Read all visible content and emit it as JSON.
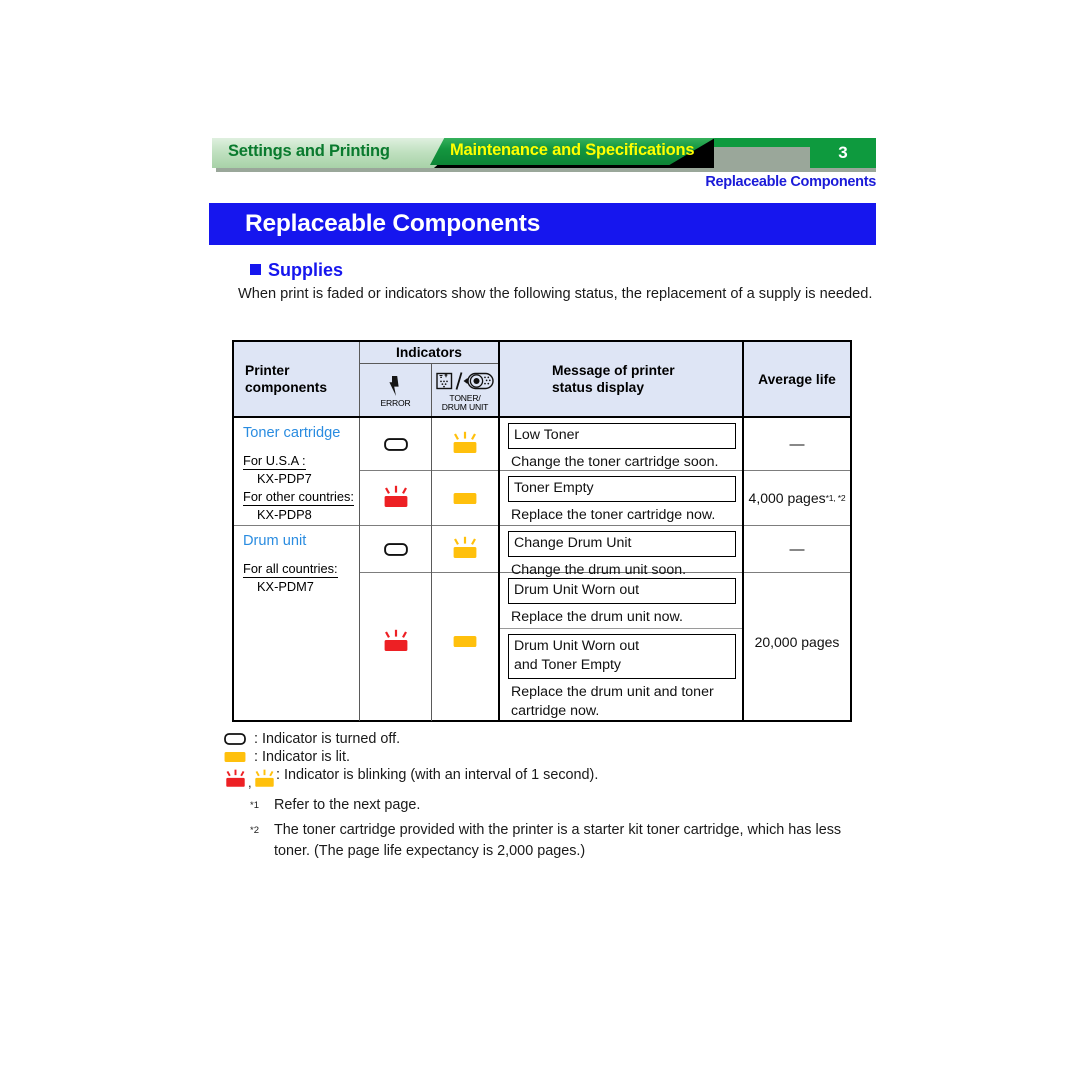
{
  "header": {
    "tab_inactive": "Settings and Printing",
    "tab_active": "Maintenance and Specifications",
    "page_number": "3",
    "running_head": "Replaceable Components",
    "colors": {
      "tab_inactive_text": "#0a7a2e",
      "tab_active_bg": "#0e9a3e",
      "tab_active_text": "#ffff00",
      "running_head_text": "#1b1bd8"
    }
  },
  "page_title": "Replaceable Components",
  "title_bg": "#1616ee",
  "section": {
    "heading": "Supplies",
    "intro": "When print is faded or indicators show the following status, the replacement of a supply is needed."
  },
  "table": {
    "headers": {
      "components": "Printer\ncomponents",
      "components_line1": "Printer",
      "components_line2": "components",
      "indicators": "Indicators",
      "error_caption": "ERROR",
      "toner_caption_line1": "TONER/",
      "toner_caption_line2": "DRUM UNIT",
      "message_line1": "Message of printer",
      "message_line2": "status display",
      "average_life": "Average life"
    },
    "header_bg": "#dee5f5",
    "groups": [
      {
        "title": "Toner cartridge",
        "sub1": "For U.S.A :",
        "model1": "KX-PDP7",
        "sub2": "For other countries:",
        "model2": "KX-PDP8",
        "rows": [
          {
            "error_lamp": "off",
            "toner_lamp": "blink-yellow",
            "message_box": "Low Toner",
            "message_text": "Change the toner cartridge soon.",
            "life": "—",
            "life_note": ""
          },
          {
            "error_lamp": "blink-red",
            "toner_lamp": "lit-yellow",
            "message_box": "Toner Empty",
            "message_text": "Replace the toner cartridge now.",
            "life": "4,000 pages",
            "life_note": "*1, *2"
          }
        ]
      },
      {
        "title": "Drum unit",
        "sub1": "For all countries:",
        "model1": "KX-PDM7",
        "sub2": "",
        "model2": "",
        "rows": [
          {
            "error_lamp": "off",
            "toner_lamp": "blink-yellow",
            "message_box": "Change Drum Unit",
            "message_text": "Change the drum unit soon.",
            "life": "—",
            "life_note": ""
          },
          {
            "error_lamp": "blink-red",
            "toner_lamp": "lit-yellow",
            "message_box": "Drum Unit Worn out",
            "message_text": "Replace the drum unit now.",
            "message_box2_line1": "Drum Unit Worn out",
            "message_box2_line2": "and Toner Empty",
            "message_text2_line1": "Replace the drum unit and toner",
            "message_text2_line2": "cartridge now.",
            "life": "20,000 pages",
            "life_note": ""
          }
        ]
      }
    ]
  },
  "legend": [
    {
      "icon": "off",
      "text": ": Indicator is turned off."
    },
    {
      "icon": "lit-yellow",
      "text": ": Indicator is lit."
    },
    {
      "icon": "blink-pair",
      "text": ": Indicator is blinking (with an interval of 1 second)."
    }
  ],
  "footnotes": [
    {
      "marker": "*1",
      "text": "Refer to the next page."
    },
    {
      "marker": "*2",
      "text": "The toner cartridge provided with the printer is a starter kit toner cartridge, which has less toner. (The page life expectancy is 2,000 pages.)"
    }
  ],
  "lamp_colors": {
    "yellow": "#FFC00C",
    "red": "#ED2024",
    "off_fill": "#ffffff",
    "off_stroke": "#111111"
  }
}
